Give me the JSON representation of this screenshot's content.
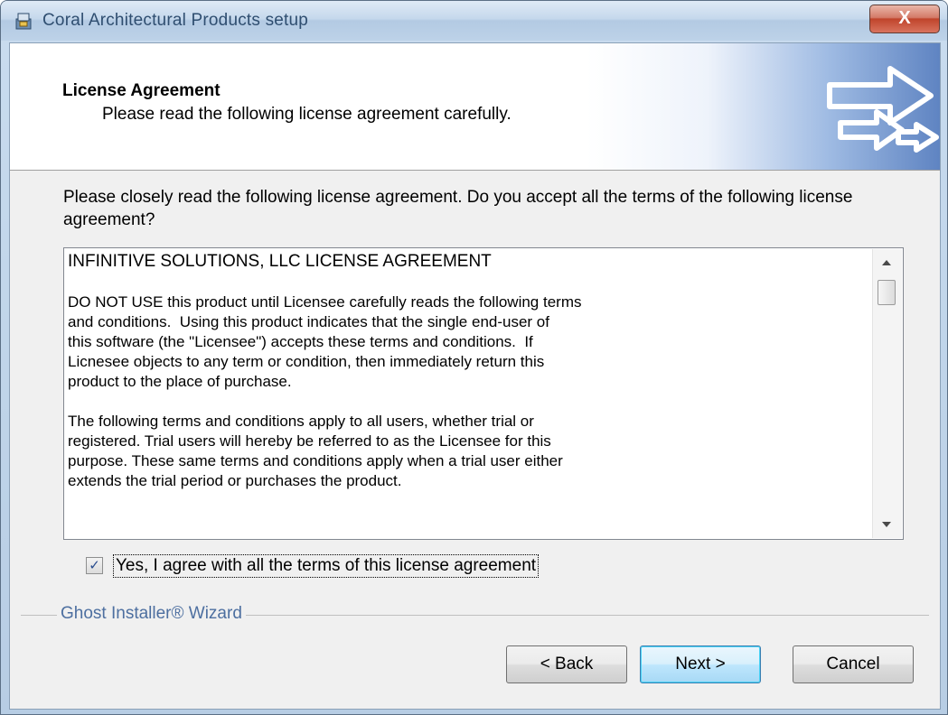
{
  "window": {
    "title": "Coral Architectural Products setup",
    "close_label": "X"
  },
  "header": {
    "title": "License Agreement",
    "subtitle": "Please read the following license agreement carefully."
  },
  "intro_text": "Please closely read the following license agreement. Do you accept all the terms of the following license agreement?",
  "license": {
    "heading": "INFINITIVE SOLUTIONS, LLC LICENSE AGREEMENT",
    "paragraphs": [
      "DO NOT USE this product until Licensee carefully reads the following terms\nand conditions.  Using this product indicates that the single end-user of\nthis software (the \"Licensee\") accepts these terms and conditions.  If\nLicnesee objects to any term or condition, then immediately return this\nproduct to the place of purchase.",
      "The following terms and conditions apply to all users, whether trial or\nregistered. Trial users will hereby be referred to as the Licensee for this\npurpose. These same terms and conditions apply when a trial user either\nextends the trial period or purchases the product."
    ]
  },
  "agree": {
    "checked": true,
    "check_glyph": "✓",
    "label": "Yes, I agree with all the terms of this license agreement"
  },
  "wizard_group_label": "Ghost Installer® Wizard",
  "buttons": {
    "back": "< Back",
    "next": "Next >",
    "cancel": "Cancel"
  }
}
